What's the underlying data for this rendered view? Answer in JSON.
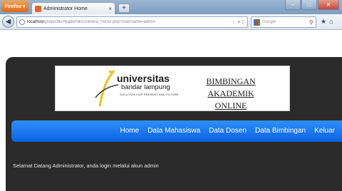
{
  "browser": {
    "app_button": "Firefox",
    "tab_title": "Administrator Home",
    "url_host": "localhost",
    "url_path": "/projectfk/Akademik/Online/a_home.php?username=admin",
    "search_placeholder": "Google"
  },
  "banner": {
    "logo_name": "universitas",
    "logo_city": "bandar lampung",
    "logo_tagline": "SOLUTION FOR PRESENT AND FUTURE",
    "title_line1": "BIMBINGAN AKADEMIK",
    "title_line2": "ONLINE"
  },
  "menu": {
    "items": [
      "Home",
      "Data Mahasiswa",
      "Data Dosen",
      "Data Bimbingan",
      "Keluar"
    ]
  },
  "content": {
    "welcome": "Selamat Datang Administrator, anda login melalui akun admin"
  },
  "colors": {
    "menu_blue": "#1a73f0",
    "site_background": "#2a2a2a"
  }
}
